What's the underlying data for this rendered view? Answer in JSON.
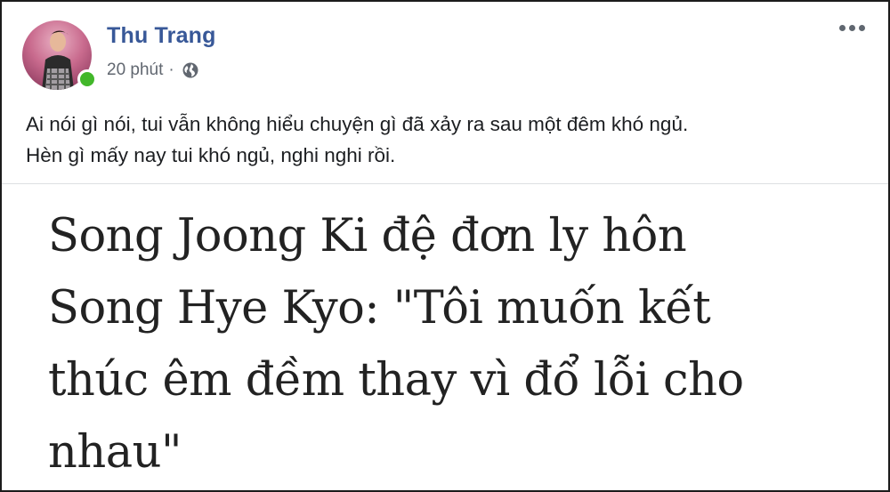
{
  "post": {
    "author_name": "Thu Trang",
    "timestamp": "20 phút",
    "separator": "·",
    "privacy_icon": "globe-icon",
    "more_icon": "more-horizontal-icon",
    "online_status_color": "#42b72a",
    "author_color": "#385898",
    "text_lines": [
      "Ai nói gì nói, tui vẫn không hiểu chuyện gì đã xảy ra sau một đêm khó ngủ.",
      "Hèn gì mấy nay tui khó ngủ, nghi nghi rồi."
    ]
  },
  "attachment": {
    "headline_lines": [
      "Song Joong Ki đệ đơn ly hôn",
      "Song Hye Kyo: \"Tôi muốn kết",
      "thúc êm đềm thay vì đổ lỗi cho",
      "nhau\""
    ]
  }
}
